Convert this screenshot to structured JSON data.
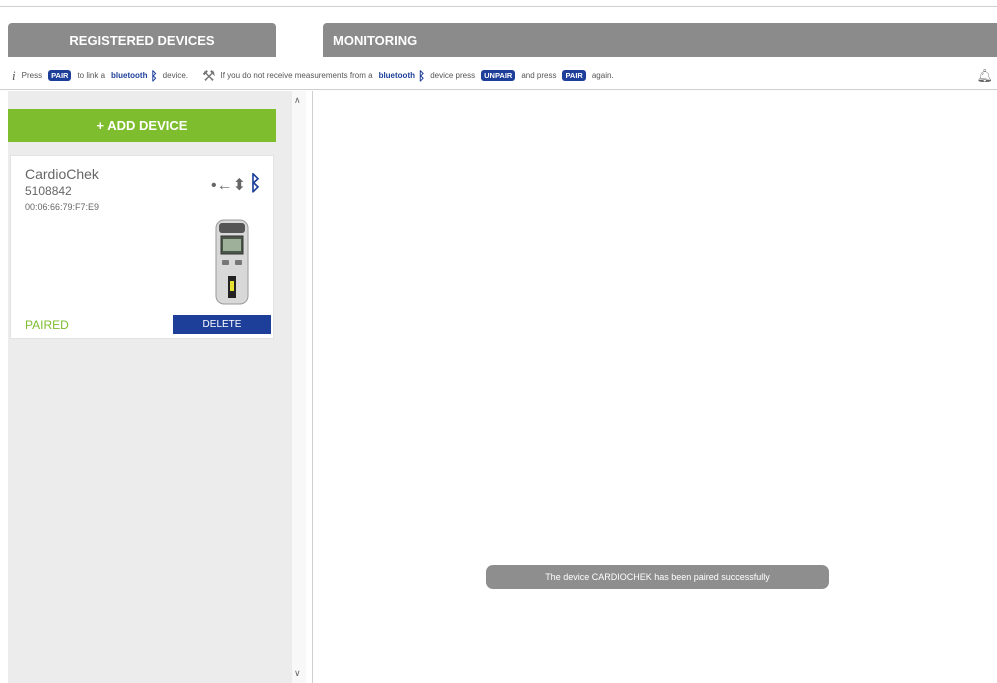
{
  "tabs": {
    "registered_devices": "REGISTERED DEVICES",
    "monitoring": "MONITORING"
  },
  "info_bar": {
    "press": "Press",
    "pair_badge": "PAIR",
    "to_link": "to link a",
    "bluetooth": "bluetooth",
    "device_period": "device.",
    "if_you": "If you do not receive measurements from a",
    "device_press": "device press",
    "unpair_badge": "UNPAIR",
    "and_press": "and press",
    "again": "again."
  },
  "sidebar": {
    "add_device_label": "+ ADD DEVICE",
    "devices": [
      {
        "name": "CardioChek",
        "serial": "5108842",
        "mac": "00:06:66:79:F7:E9",
        "status": "PAIRED",
        "delete_label": "DELETE"
      }
    ]
  },
  "toast": {
    "message": "The device CARDIOCHEK has been paired successfully"
  },
  "colors": {
    "accent_green": "#7ebd2e",
    "brand_blue": "#1d3f9a",
    "tab_gray": "#8b8b8b",
    "sidebar_bg": "#ececec"
  },
  "icons": [
    "info-icon",
    "bluetooth-icon",
    "tools-icon",
    "bell-icon",
    "usb-icon",
    "scroll-up-icon",
    "scroll-down-icon"
  ]
}
